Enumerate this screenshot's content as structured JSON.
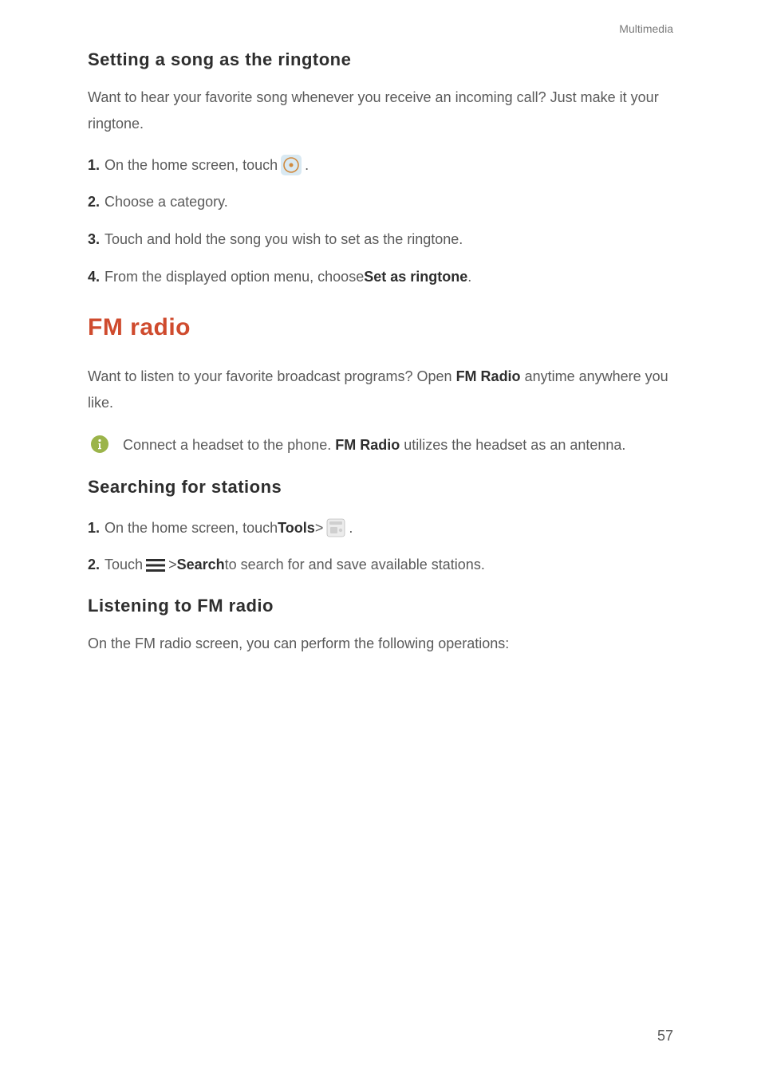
{
  "header": {
    "section": "Multimedia"
  },
  "sec1": {
    "heading": "Setting a song as the ringtone",
    "intro": "Want to hear your favorite song whenever you receive an incoming call? Just make it your ringtone.",
    "steps": {
      "s1": {
        "num": "1.",
        "text": "On the home screen, touch",
        "after": "."
      },
      "s2": {
        "num": "2.",
        "text": "Choose a category."
      },
      "s3": {
        "num": "3.",
        "text": "Touch and hold the song you wish to set as the ringtone."
      },
      "s4": {
        "num": "4.",
        "pre": "From the displayed option menu, choose ",
        "strong": "Set as ringtone",
        "post": "."
      }
    }
  },
  "sec2": {
    "heading": "FM radio",
    "intro_pre": "Want to listen to your favorite broadcast programs? Open ",
    "intro_strong": "FM Radio",
    "intro_post": " anytime anywhere you like.",
    "info_pre": "Connect a headset to the phone. ",
    "info_strong": "FM Radio",
    "info_post": " utilizes the headset as an antenna."
  },
  "sec3": {
    "heading": "Searching for stations",
    "s1": {
      "num": "1.",
      "pre": "On the home screen, touch ",
      "strong": "Tools",
      "mid": " > ",
      "after": "."
    },
    "s2": {
      "num": "2.",
      "pre": "Touch ",
      "mid": " > ",
      "strong": "Search",
      "post": " to search for and save available stations."
    }
  },
  "sec4": {
    "heading": "Listening to FM radio",
    "body": "On the FM radio screen, you can perform the following operations:"
  },
  "page_number": "57"
}
